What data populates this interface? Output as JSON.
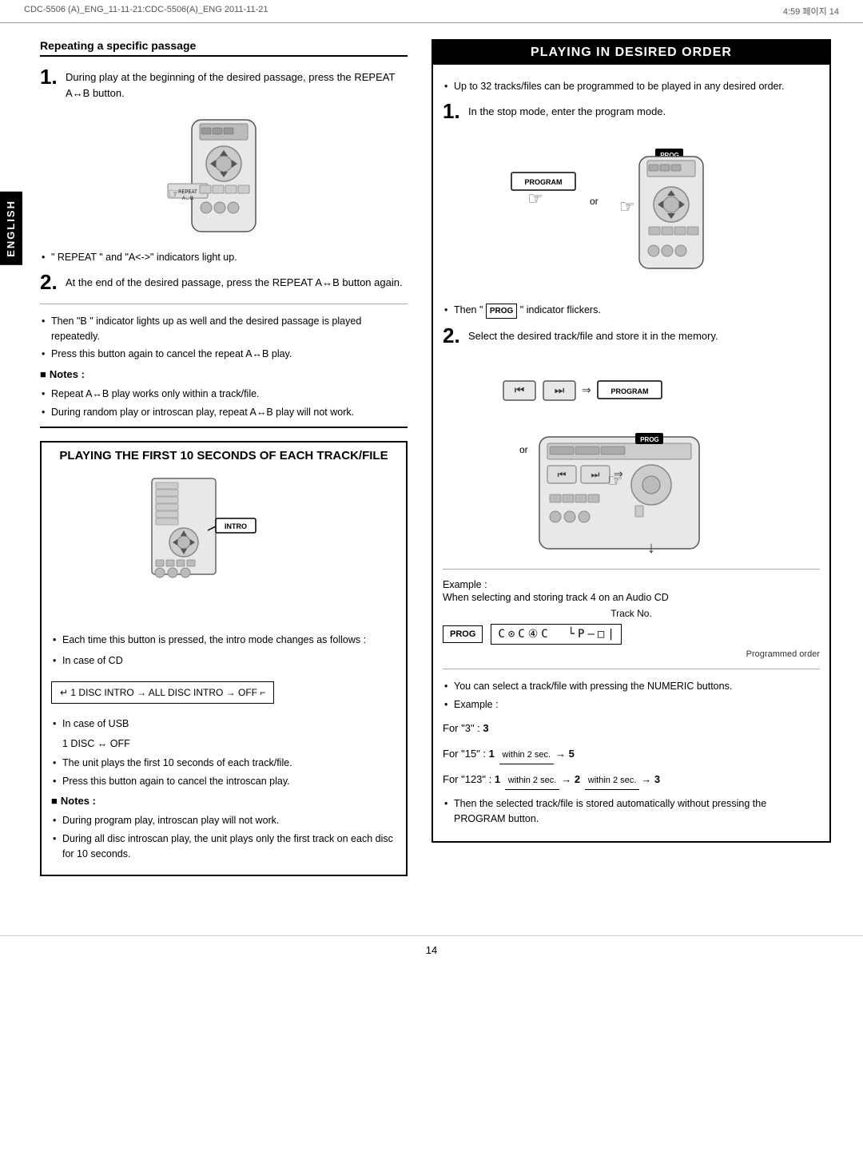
{
  "header": {
    "left": "CDC-5506 (A)_ENG_11-11-21:CDC-5506(A)_ENG  2011-11-21",
    "right": "4:59  페이지 14"
  },
  "english_label": "ENGLISH",
  "left_section": {
    "title": "Repeating a specific passage",
    "step1": {
      "number": "1.",
      "text": "During play at the beginning of the desired passage, press the REPEAT A↔B button."
    },
    "bullet1": "\" REPEAT \"  and \"A<->\" indicators light up.",
    "step2": {
      "number": "2.",
      "text": "At the end of the desired passage, press the REPEAT A↔B button again."
    },
    "bullets_after_step2": [
      "Then \"B \" indicator lights up as well and the desired passage is played repeatedly.",
      "Press this button again to cancel the repeat A↔B play."
    ],
    "notes_header": "Notes :",
    "notes": [
      "Repeat A↔B play works only within a track/file.",
      "During random play or introscan play, repeat A↔B play will not work."
    ]
  },
  "intro_section": {
    "title": "PLAYING THE FIRST 10 SECONDS OF EACH TRACK/FILE",
    "bullets": [
      "Each time this button is pressed, the intro mode changes as follows :",
      "In case of CD",
      "In case of USB"
    ],
    "cd_flow": "1 DISC INTRO → ALL DISC INTRO → OFF",
    "usb_flow": "1 DISC ↔ OFF",
    "bullets2": [
      "The unit plays the first 10 seconds of each track/file.",
      "Press this button again to cancel the introscan play."
    ],
    "notes_header": "Notes :",
    "notes2": [
      "During program play, introscan play will not work.",
      "During all disc introscan play, the unit plays only the first track on each disc for 10 seconds."
    ]
  },
  "right_section": {
    "title": "PLAYING IN DESIRED ORDER",
    "intro_bullet": "Up to 32 tracks/files can be programmed to be played in any desired order.",
    "step1": {
      "number": "1.",
      "text": "In the stop mode, enter the program mode."
    },
    "then_prog": "Then \" PROG \" indicator flickers.",
    "step2": {
      "number": "2.",
      "text": "Select the desired track/file and store it in the memory."
    },
    "example_label": "Example :",
    "example_text": "When selecting and storing track 4 on an Audio CD",
    "track_no_label": "Track No.",
    "programmed_order": "Programmed order",
    "bullets_final": [
      "You can select a track/file with pressing the NUMERIC buttons.",
      "Example :"
    ],
    "for3_label": "For \"3\" :",
    "for3_value": "3",
    "for15_label": "For \"15\" :",
    "for15_1": "1",
    "for15_within": "within 2 sec.",
    "for15_5": "5",
    "for123_label": "For \"123\" :",
    "for123_1": "1",
    "for123_within1": "within 2 sec.",
    "for123_2": "2",
    "for123_within2": "within 2 sec.",
    "for123_3": "3",
    "then_stored": "Then the selected track/file is stored automatically without pressing the PROGRAM button."
  },
  "page_number": "14"
}
